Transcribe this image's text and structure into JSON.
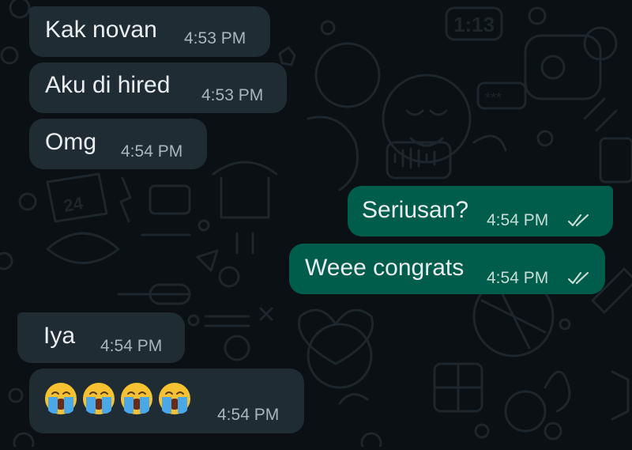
{
  "chat": {
    "messages": [
      {
        "direction": "incoming",
        "text": "Kak novan",
        "time": "4:53 PM"
      },
      {
        "direction": "incoming",
        "text": "Aku di hired",
        "time": "4:53 PM"
      },
      {
        "direction": "incoming",
        "text": "Omg",
        "time": "4:54 PM"
      },
      {
        "direction": "outgoing",
        "text": "Seriusan?",
        "time": "4:54 PM",
        "status": "read"
      },
      {
        "direction": "outgoing",
        "text": "Weee congrats",
        "time": "4:54 PM",
        "status": "read"
      },
      {
        "direction": "incoming",
        "text": "Iya",
        "time": "4:54 PM"
      },
      {
        "direction": "incoming",
        "emoji": [
          "loudly-crying-face",
          "loudly-crying-face",
          "loudly-crying-face",
          "loudly-crying-face"
        ],
        "time": "4:54 PM"
      }
    ]
  },
  "wallpaper": {
    "clock_text": "1:13",
    "calendar_text": "24",
    "password_text": "***"
  },
  "colors": {
    "background": "#0b1014",
    "incoming_bubble": "#1f2c34",
    "outgoing_bubble": "#005c4b",
    "doodle": "#1c262c",
    "text": "#e9edef",
    "time": "#a9b6bd"
  }
}
